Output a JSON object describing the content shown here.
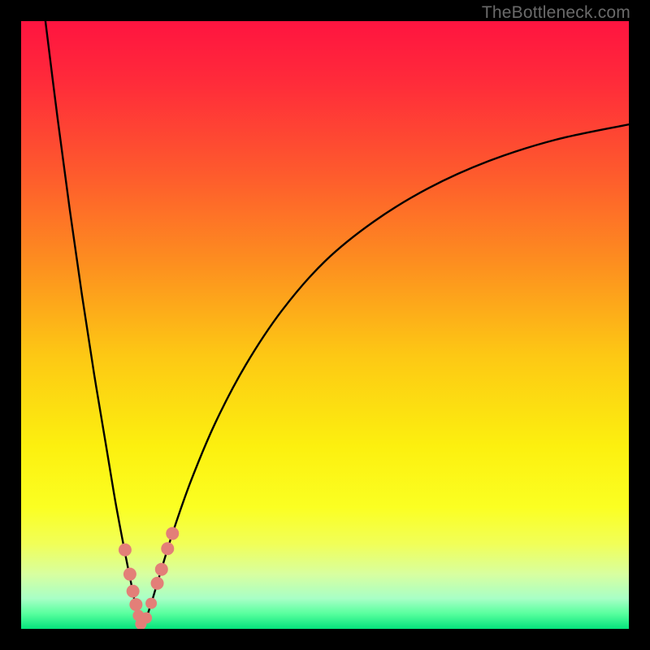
{
  "watermark": "TheBottleneck.com",
  "chart_data": {
    "type": "line",
    "title": "",
    "xlabel": "",
    "ylabel": "",
    "xlim": [
      0,
      100
    ],
    "ylim": [
      0,
      100
    ],
    "gradient_stops": [
      {
        "offset": 0.0,
        "color": "#ff1440"
      },
      {
        "offset": 0.1,
        "color": "#ff2b3a"
      },
      {
        "offset": 0.25,
        "color": "#fe5a2d"
      },
      {
        "offset": 0.4,
        "color": "#fd8f1f"
      },
      {
        "offset": 0.55,
        "color": "#fdc814"
      },
      {
        "offset": 0.7,
        "color": "#fcf00f"
      },
      {
        "offset": 0.8,
        "color": "#fbff22"
      },
      {
        "offset": 0.86,
        "color": "#f1ff58"
      },
      {
        "offset": 0.91,
        "color": "#d8ffa0"
      },
      {
        "offset": 0.95,
        "color": "#a8ffc6"
      },
      {
        "offset": 0.975,
        "color": "#58ff9e"
      },
      {
        "offset": 1.0,
        "color": "#05e27c"
      }
    ],
    "series": [
      {
        "name": "left-branch",
        "x": [
          4.0,
          6.0,
          8.0,
          10.0,
          12.0,
          14.0,
          15.5,
          17.0,
          18.0,
          18.8,
          19.4,
          19.7,
          19.9
        ],
        "y": [
          100.0,
          84.0,
          69.0,
          55.0,
          42.0,
          30.0,
          21.0,
          13.0,
          8.0,
          4.0,
          1.8,
          0.6,
          0.0
        ]
      },
      {
        "name": "right-branch",
        "x": [
          19.9,
          20.5,
          21.5,
          23.0,
          25.0,
          28.0,
          32.0,
          37.0,
          43.0,
          50.0,
          58.0,
          67.0,
          77.0,
          88.0,
          100.0
        ],
        "y": [
          0.0,
          1.5,
          4.5,
          9.5,
          16.0,
          24.5,
          34.0,
          43.5,
          52.5,
          60.5,
          67.0,
          72.5,
          77.0,
          80.5,
          83.0
        ]
      }
    ],
    "markers": {
      "name": "highlighted-points",
      "color": "#e37f78",
      "points": [
        {
          "x": 17.1,
          "y": 13.0,
          "r": 8
        },
        {
          "x": 17.9,
          "y": 9.0,
          "r": 8
        },
        {
          "x": 18.4,
          "y": 6.2,
          "r": 8
        },
        {
          "x": 18.9,
          "y": 4.0,
          "r": 8
        },
        {
          "x": 19.3,
          "y": 2.2,
          "r": 7
        },
        {
          "x": 19.7,
          "y": 0.8,
          "r": 7
        },
        {
          "x": 20.6,
          "y": 1.8,
          "r": 7
        },
        {
          "x": 21.4,
          "y": 4.2,
          "r": 7
        },
        {
          "x": 22.4,
          "y": 7.5,
          "r": 8
        },
        {
          "x": 23.1,
          "y": 9.8,
          "r": 8
        },
        {
          "x": 24.1,
          "y": 13.2,
          "r": 8
        },
        {
          "x": 24.9,
          "y": 15.7,
          "r": 8
        }
      ]
    },
    "legend": null,
    "grid": false
  }
}
